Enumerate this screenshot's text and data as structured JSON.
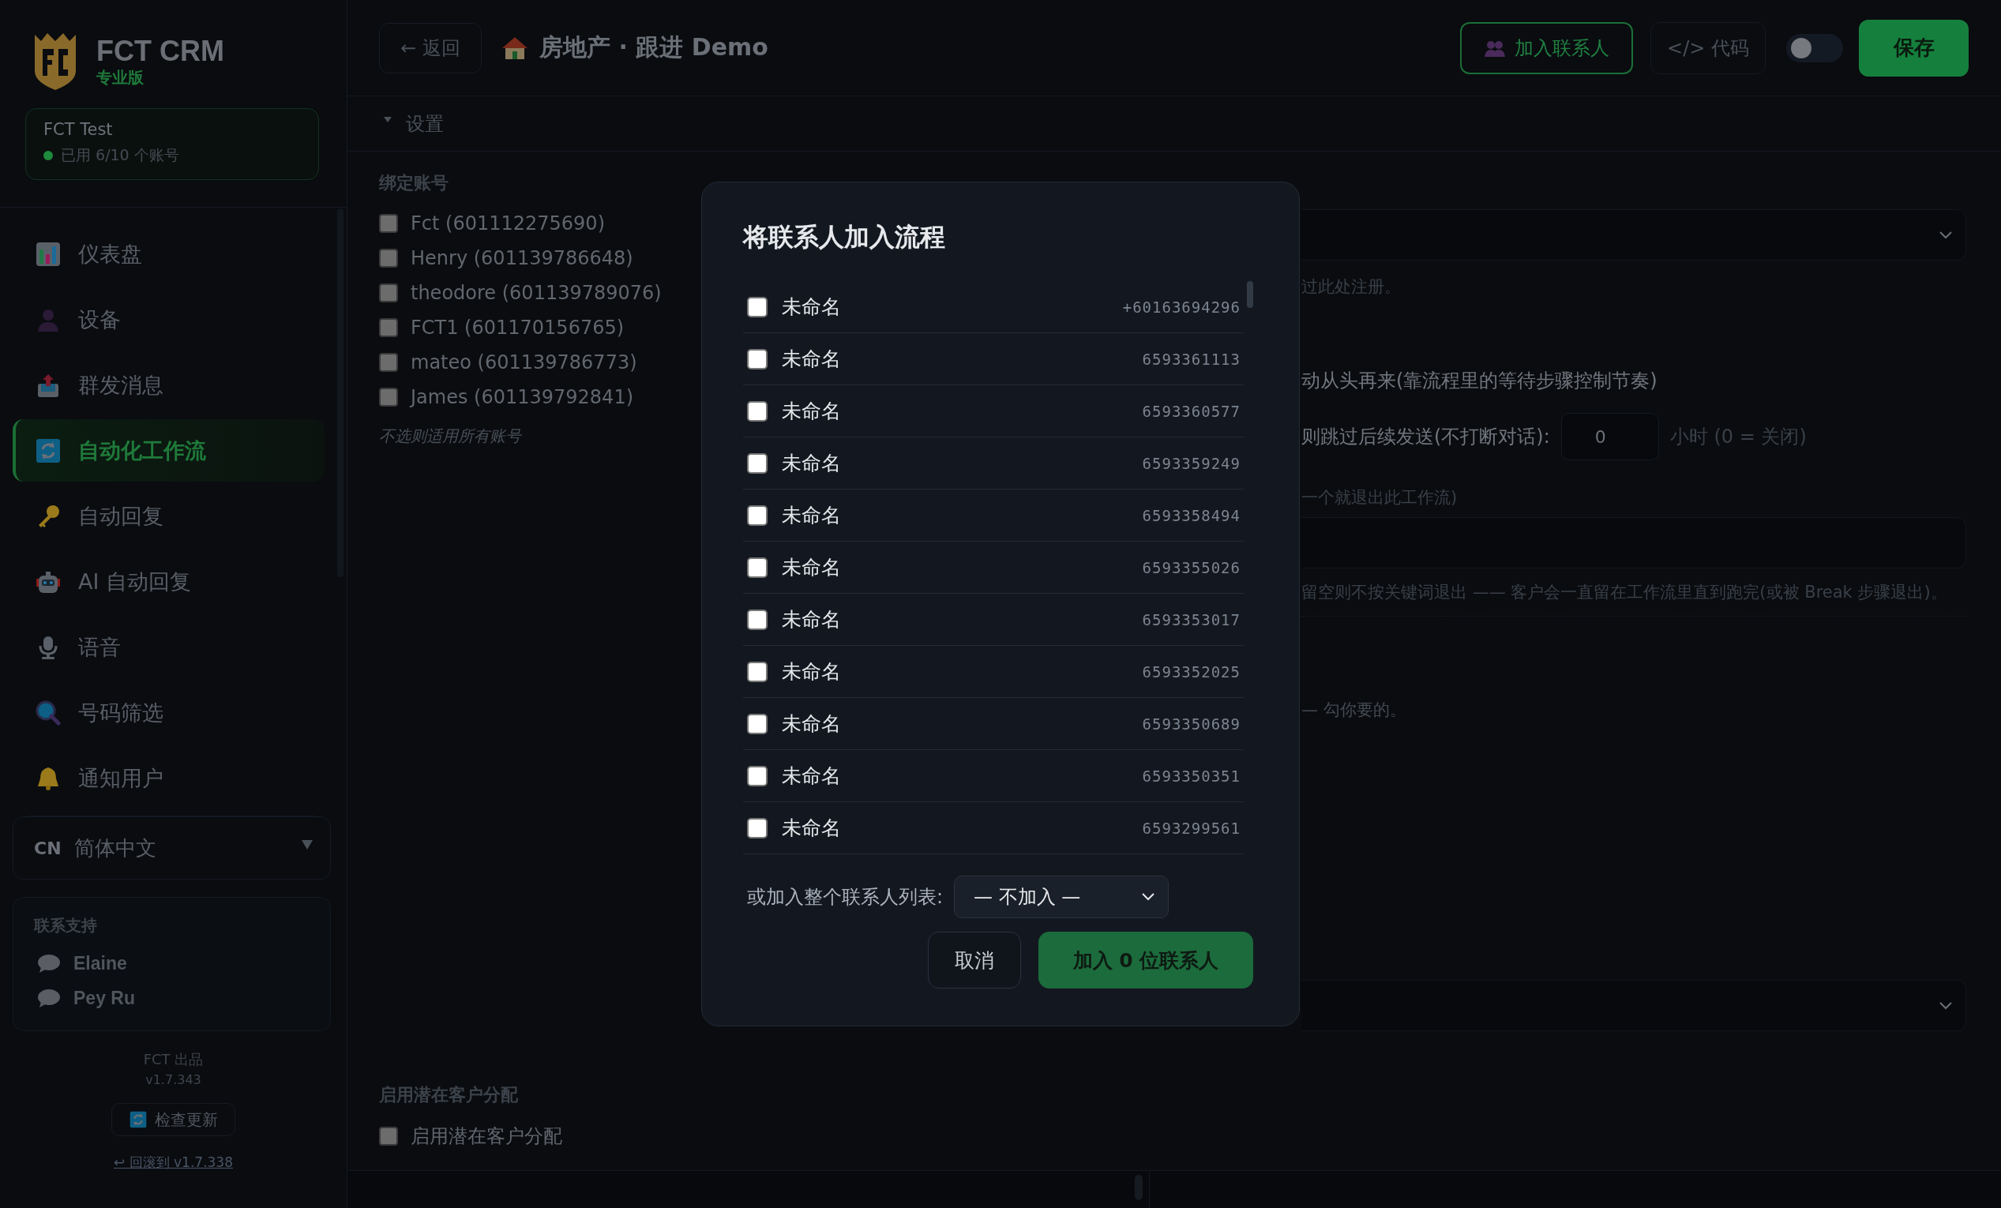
{
  "sidebar": {
    "brand": {
      "name": "FCT CRM",
      "edition": "专业版"
    },
    "account": {
      "name": "FCT Test",
      "usage": "已用 6/10 个账号",
      "online": true
    },
    "nav": [
      {
        "label": "仪表盘",
        "selected": false
      },
      {
        "label": "设备",
        "selected": false
      },
      {
        "label": "群发消息",
        "selected": false
      },
      {
        "label": "自动化工作流",
        "selected": true
      },
      {
        "label": "自动回复",
        "selected": false
      },
      {
        "label": "AI 自动回复",
        "selected": false
      },
      {
        "label": "语音",
        "selected": false
      },
      {
        "label": "号码筛选",
        "selected": false
      },
      {
        "label": "通知用户",
        "selected": false
      }
    ],
    "language": {
      "code": "CN",
      "label": "简体中文"
    },
    "support": {
      "title": "联系支持",
      "contacts": [
        "Elaine",
        "Pey Ru"
      ]
    },
    "footer": {
      "credit": "FCT 出品",
      "version": "v1.7.343",
      "update_button": "检查更新",
      "rollback_link": "↩ 回滚到 v1.7.338"
    }
  },
  "toolbar": {
    "back": "← 返回",
    "title": "房地产 · 跟进 Demo",
    "add_contacts": "加入联系人",
    "code": "</> 代码",
    "toggle": {
      "on": false
    },
    "save": "保存"
  },
  "settings": {
    "header": "设置",
    "expanded": true,
    "bound_accounts": {
      "title": "绑定账号",
      "hint": "不选则适用所有账号",
      "accounts": [
        {
          "label": "Fct (601112275690)",
          "checked": false
        },
        {
          "label": "Henry (601139786648)",
          "checked": false
        },
        {
          "label": "theodore (601139789076)",
          "checked": false
        },
        {
          "label": "FCT1 (601170156765)",
          "checked": false
        },
        {
          "label": "mateo (601139786773)",
          "checked": false
        },
        {
          "label": "James (601139792841)",
          "checked": false
        }
      ]
    },
    "right_panel": {
      "register_hint": "过此处注册。",
      "restart_text": "动从头再来(靠流程里的等待步骤控制节奏)",
      "skip_label": "则跳过后续发送(不打断对话):",
      "skip_value": "0",
      "skip_unit": "小时 (0 = 关闭)",
      "exit_label": "一个就退出此工作流)",
      "exit_hint": "留空则不按关键词退出 —— 客户会一直留在工作流里直到跑完(或被 Break 步骤退出)。",
      "pick_hint": "— 勾你要的。"
    },
    "lead_assignment": {
      "title": "启用潜在客户分配",
      "label": "启用潜在客户分配",
      "checked": false
    }
  },
  "modal": {
    "title": "将联系人加入流程",
    "contacts": [
      {
        "name": "未命名",
        "phone": "+60163694296",
        "checked": false
      },
      {
        "name": "未命名",
        "phone": "6593361113",
        "checked": false
      },
      {
        "name": "未命名",
        "phone": "6593360577",
        "checked": false
      },
      {
        "name": "未命名",
        "phone": "6593359249",
        "checked": false
      },
      {
        "name": "未命名",
        "phone": "6593358494",
        "checked": false
      },
      {
        "name": "未命名",
        "phone": "6593355026",
        "checked": false
      },
      {
        "name": "未命名",
        "phone": "6593353017",
        "checked": false
      },
      {
        "name": "未命名",
        "phone": "6593352025",
        "checked": false
      },
      {
        "name": "未命名",
        "phone": "6593350689",
        "checked": false
      },
      {
        "name": "未命名",
        "phone": "6593350351",
        "checked": false
      },
      {
        "name": "未命名",
        "phone": "6593299561",
        "checked": false
      }
    ],
    "list_label": "或加入整个联系人列表:",
    "list_select": "— 不加入 —",
    "cancel": "取消",
    "confirm": "加入 0 位联系人"
  }
}
